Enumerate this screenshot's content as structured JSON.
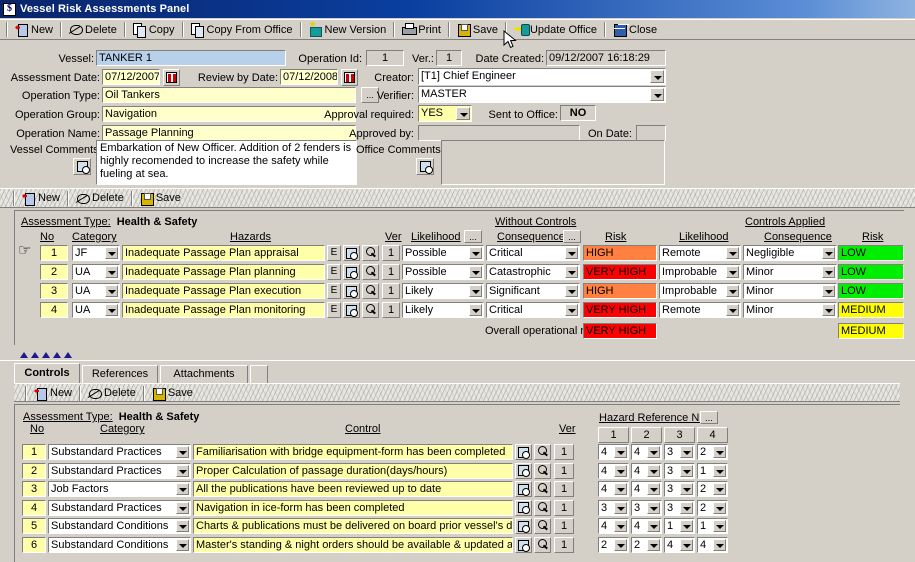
{
  "window": {
    "title": "Vessel Risk Assessments Panel",
    "icon": "dollar-app-icon"
  },
  "toolbar": {
    "items": [
      {
        "label": "New",
        "icon": "new-icon"
      },
      {
        "label": "Delete",
        "icon": "delete-icon"
      },
      {
        "label": "Copy",
        "icon": "copy-icon"
      },
      {
        "label": "Copy From Office",
        "icon": "copy-from-office-icon"
      },
      {
        "label": "New Version",
        "icon": "new-version-icon"
      },
      {
        "label": "Print",
        "icon": "print-icon"
      },
      {
        "label": "Save",
        "icon": "save-icon"
      },
      {
        "label": "Update Office",
        "icon": "update-office-icon"
      },
      {
        "label": "Close",
        "icon": "close-icon"
      }
    ]
  },
  "header": {
    "vessel_label": "Vessel:",
    "vessel_value": "TANKER 1",
    "operation_id_label": "Operation Id:",
    "operation_id_value": "1",
    "ver_label": "Ver.:",
    "ver_value": "1",
    "date_created_label": "Date Created:",
    "date_created_value": "09/12/2007 16:18:29",
    "assessment_date_label": "Assessment Date:",
    "assessment_date_value": "07/12/2007",
    "review_by_date_label": "Review by Date:",
    "review_by_date_value": "07/12/2008",
    "creator_label": "Creator:",
    "creator_value": "[T1]   Chief Engineer",
    "operation_type_label": "Operation Type:",
    "operation_type_value": "Oil Tankers",
    "verifier_label": "Verifier:",
    "verifier_value": "MASTER",
    "operation_group_label": "Operation Group:",
    "operation_group_value": "Navigation",
    "approval_required_label": "Approval required:",
    "approval_required_value": "YES",
    "sent_to_office_label": "Sent to Office:",
    "sent_to_office_value": "NO",
    "operation_name_label": "Operation Name:",
    "operation_name_value": "Passage Planning",
    "approved_by_label": "Approved by:",
    "approved_by_value": "",
    "on_date_label": "On Date:",
    "on_date_value": "",
    "vessel_comments_label": "Vessel Comments:",
    "vessel_comments_value": "Embarkation of New Officer. Addition of 2 fenders is highly recomended to increase the safety while fueling at sea.",
    "office_comments_label": "Office Comments:",
    "office_comments_value": "",
    "ellipsis": "..."
  },
  "hazards_toolbar": {
    "items": [
      {
        "label": "New",
        "icon": "new-icon"
      },
      {
        "label": "Delete",
        "icon": "delete-icon"
      },
      {
        "label": "Save",
        "icon": "save-icon"
      }
    ]
  },
  "hazards": {
    "assessment_type_label": "Assessment Type:",
    "assessment_type_value": "Health & Safety",
    "group_without_controls": "Without Controls",
    "group_controls_applied": "Controls Applied",
    "columns": {
      "no": "No",
      "category": "Category",
      "hazards": "Hazards",
      "ver": "Ver",
      "likelihood": "Likelihood",
      "consequence": "Consequence",
      "risk": "Risk",
      "ellipsis": "..."
    },
    "edit_btn": "E",
    "rows": [
      {
        "no": "1",
        "category": "JF",
        "hazard": "Inadequate Passage Plan appraisal",
        "ver": "1",
        "likelihood": "Possible",
        "consequence": "Critical",
        "risk": "HIGH",
        "risk_color": "#ff8040",
        "c_likelihood": "Remote",
        "c_consequence": "Negligible",
        "c_risk": "LOW",
        "c_risk_color": "#00ee00",
        "selected": true
      },
      {
        "no": "2",
        "category": "UA",
        "hazard": "Inadequate Passage Plan planning",
        "ver": "1",
        "likelihood": "Possible",
        "consequence": "Catastrophic",
        "risk": "VERY HIGH",
        "risk_color": "#ff0000",
        "c_likelihood": "Improbable",
        "c_consequence": "Minor",
        "c_risk": "LOW",
        "c_risk_color": "#00ee00",
        "selected": false
      },
      {
        "no": "3",
        "category": "UA",
        "hazard": "Inadequate Passage Plan execution",
        "ver": "1",
        "likelihood": "Likely",
        "consequence": "Significant",
        "risk": "HIGH",
        "risk_color": "#ff8040",
        "c_likelihood": "Improbable",
        "c_consequence": "Minor",
        "c_risk": "LOW",
        "c_risk_color": "#00ee00",
        "selected": false
      },
      {
        "no": "4",
        "category": "UA",
        "hazard": "Inadequate Passage Plan monitoring",
        "ver": "1",
        "likelihood": "Likely",
        "consequence": "Critical",
        "risk": "VERY HIGH",
        "risk_color": "#ff0000",
        "c_likelihood": "Remote",
        "c_consequence": "Minor",
        "c_risk": "MEDIUM",
        "c_risk_color": "#ffff00",
        "selected": false
      }
    ],
    "overall_label": "Overall operational risk:",
    "overall_risk": "VERY HIGH",
    "overall_risk_color": "#ff0000",
    "overall_controlled_risk": "MEDIUM",
    "overall_controlled_color": "#ffff00"
  },
  "tabs": {
    "items": [
      {
        "label": "Controls",
        "selected": true
      },
      {
        "label": "References",
        "selected": false
      },
      {
        "label": "Attachments",
        "selected": false
      }
    ]
  },
  "controls_toolbar": {
    "items": [
      {
        "label": "New",
        "icon": "new-icon"
      },
      {
        "label": "Delete",
        "icon": "delete-icon"
      },
      {
        "label": "Save",
        "icon": "save-icon"
      }
    ]
  },
  "controls": {
    "assessment_type_label": "Assessment Type:",
    "assessment_type_value": "Health & Safety",
    "columns": {
      "no": "No",
      "category": "Category",
      "control": "Control",
      "ver": "Ver"
    },
    "hazard_ref_label": "Hazard Reference Nr",
    "hazard_ref_ellipsis": "...",
    "hazard_ref_cols": [
      "1",
      "2",
      "3",
      "4"
    ],
    "rows": [
      {
        "no": "1",
        "category": "Substandard Practices",
        "control": "Familiarisation with bridge equipment-form has been completed",
        "ver": "1",
        "refs": [
          "4",
          "4",
          "3",
          "2"
        ]
      },
      {
        "no": "2",
        "category": "Substandard Practices",
        "control": "Proper Calculation of passage duration(days/hours)",
        "ver": "1",
        "refs": [
          "4",
          "4",
          "3",
          "1"
        ]
      },
      {
        "no": "3",
        "category": "Job Factors",
        "control": "All the publications have been reviewed up to date",
        "ver": "1",
        "refs": [
          "4",
          "4",
          "3",
          "2"
        ]
      },
      {
        "no": "4",
        "category": "Substandard Practices",
        "control": "Navigation in ice-form has been completed",
        "ver": "1",
        "refs": [
          "3",
          "3",
          "3",
          "2"
        ]
      },
      {
        "no": "5",
        "category": "Substandard Conditions",
        "control": "Charts & publications must be delivered on board prior vessel's departure",
        "ver": "1",
        "refs": [
          "4",
          "4",
          "1",
          "1"
        ]
      },
      {
        "no": "6",
        "category": "Substandard Conditions",
        "control": "Master's standing & night orders should be available & updated at bridge",
        "ver": "1",
        "refs": [
          "2",
          "2",
          "4",
          "4"
        ]
      }
    ]
  }
}
